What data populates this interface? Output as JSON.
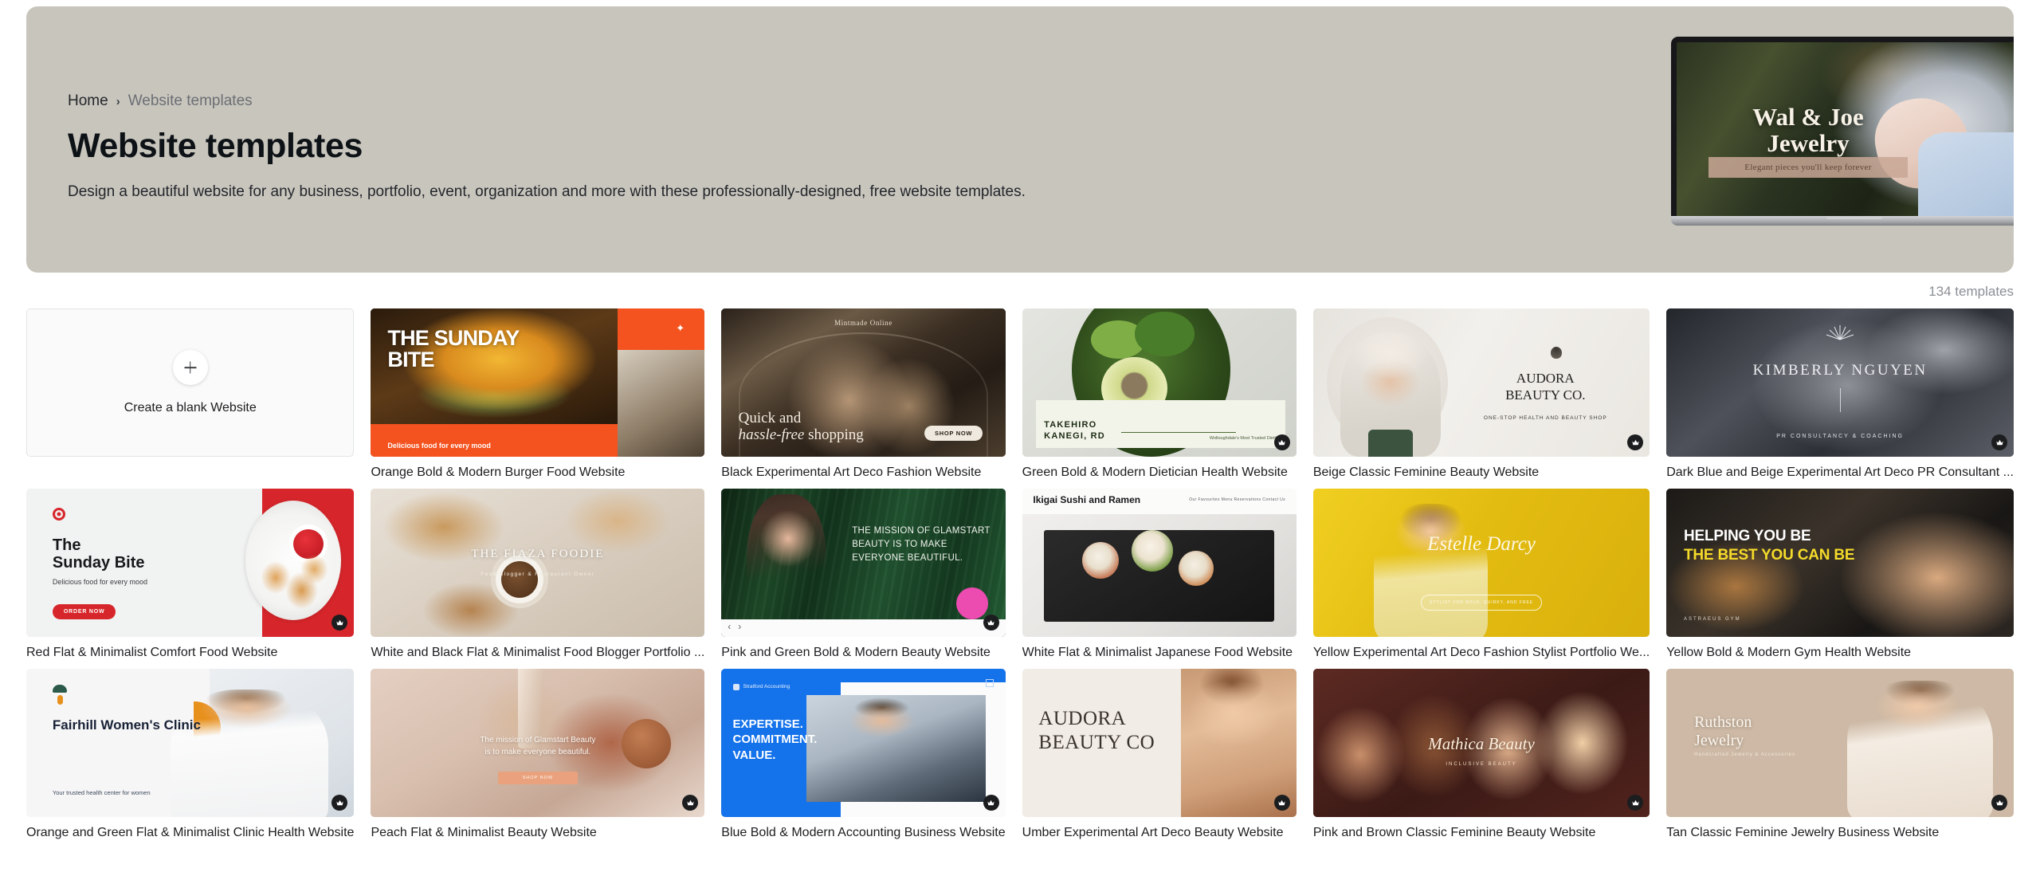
{
  "hero": {
    "breadcrumb": {
      "home": "Home",
      "separator": "›",
      "current": "Website templates"
    },
    "title": "Website templates",
    "description": "Design a beautiful website for any business, portfolio, event, organization and more with these professionally-designed, free website templates.",
    "mockup": {
      "brand_line1": "Wal & Joe",
      "brand_line2": "Jewelry",
      "cta": "Elegant pieces you'll keep forever"
    }
  },
  "count_label": "134 templates",
  "blank_card": {
    "label": "Create a blank Website",
    "icon": "plus-icon"
  },
  "badges": {
    "pro": "crown-icon"
  },
  "cards": [
    {
      "id": "orange-burger",
      "label": "Orange Bold & Modern Burger Food Website",
      "pro": false,
      "content": {
        "headline": "THE SUNDAY BITE",
        "subtext": "Delicious food for every mood",
        "spark": "✦"
      }
    },
    {
      "id": "black-fashion",
      "label": "Black Experimental Art Deco Fashion Website",
      "pro": false,
      "content": {
        "brand": "Mintmade Online",
        "headline_a": "Quick and",
        "headline_b": "hassle-free",
        "headline_c": " shopping",
        "button": "SHOP NOW"
      }
    },
    {
      "id": "green-dietician",
      "label": "Green Bold & Modern Dietician Health Website",
      "pro": true,
      "content": {
        "name_line1": "TAKEHIRO",
        "name_line2": "KANEGI, RD",
        "tagline": "Wolloughdale's Most Trusted Dietitian"
      }
    },
    {
      "id": "beige-audora",
      "label": "Beige Classic Feminine Beauty Website",
      "pro": true,
      "content": {
        "name_line1": "AUDORA",
        "name_line2": "BEAUTY CO.",
        "tagline": "ONE-STOP HEALTH AND BEAUTY SHOP"
      }
    },
    {
      "id": "darkblue-kimberly",
      "label": "Dark Blue and Beige Experimental Art Deco PR Consultant ...",
      "pro": true,
      "content": {
        "name": "KIMBERLY NGUYEN",
        "tagline": "PR CONSULTANCY & COACHING"
      }
    },
    {
      "id": "red-comfort-food",
      "label": "Red Flat & Minimalist Comfort Food Website",
      "pro": true,
      "content": {
        "headline_a": "The",
        "headline_b": "Sunday Bite",
        "subtext": "Delicious food for every mood",
        "button": "ORDER NOW"
      }
    },
    {
      "id": "fiaza-foodie",
      "label": "White and Black Flat & Minimalist Food Blogger Portfolio ...",
      "pro": false,
      "content": {
        "headline": "THE FIAZA FOODIE",
        "subtext": "Food Blogger & Restaurant Owner"
      }
    },
    {
      "id": "pink-green-beauty",
      "label": "Pink and Green Bold & Modern Beauty Website",
      "pro": true,
      "content": {
        "headline": "THE MISSION OF GLAMSTART BEAUTY IS TO MAKE EVERYONE BEAUTIFUL.",
        "prev": "‹",
        "next": "›"
      }
    },
    {
      "id": "japanese-food",
      "label": "White Flat & Minimalist Japanese Food Website",
      "pro": false,
      "content": {
        "brand": "Ikigai Sushi and Ramen",
        "nav": "Our Favourites  Menu  Reservations  Contact Us"
      }
    },
    {
      "id": "estelle-darcy",
      "label": "Yellow Experimental Art Deco Fashion Stylist Portfolio We...",
      "pro": false,
      "content": {
        "name": "Estelle Darcy",
        "pill": "STYLIST FOR BOLD, QUIRKY, AND FREE"
      }
    },
    {
      "id": "yellow-gym",
      "label": "Yellow Bold & Modern Gym Health Website",
      "pro": false,
      "content": {
        "headline_a": "HELPING YOU BE",
        "headline_b": "THE BEST YOU CAN BE",
        "tagline": "ASTRAEUS GYM"
      }
    },
    {
      "id": "fairhill-clinic",
      "label": "Orange and Green Flat & Minimalist Clinic Health Website",
      "pro": true,
      "content": {
        "headline": "Fairhill Women's Clinic",
        "subtext": "Your trusted health center for women"
      }
    },
    {
      "id": "peach-beauty",
      "label": "Peach Flat & Minimalist Beauty Website",
      "pro": true,
      "content": {
        "headline_a": "The mission of Glamstart Beauty",
        "headline_b": "is to make everyone beautiful.",
        "button": "SHOP NOW"
      }
    },
    {
      "id": "blue-accounting",
      "label": "Blue Bold & Modern Accounting Business Website",
      "pro": true,
      "content": {
        "logo": "Stratford Accounting",
        "headline_a": "EXPERTISE.",
        "headline_b": "COMMITMENT.",
        "headline_c": "VALUE."
      }
    },
    {
      "id": "umber-audora",
      "label": "Umber Experimental Art Deco Beauty Website",
      "pro": true,
      "content": {
        "name_line1": "AUDORA",
        "name_line2": "BEAUTY CO"
      }
    },
    {
      "id": "mathica-beauty",
      "label": "Pink and Brown Classic Feminine Beauty Website",
      "pro": true,
      "content": {
        "name": "Mathica Beauty",
        "tagline": "INCLUSIVE BEAUTY"
      }
    },
    {
      "id": "ruthston-jewelry",
      "label": "Tan Classic Feminine Jewelry Business Website",
      "pro": true,
      "content": {
        "name_line1": "Ruthston",
        "name_line2": "Jewelry",
        "tagline": "Handcrafted Jewelry & Accessories"
      }
    }
  ]
}
